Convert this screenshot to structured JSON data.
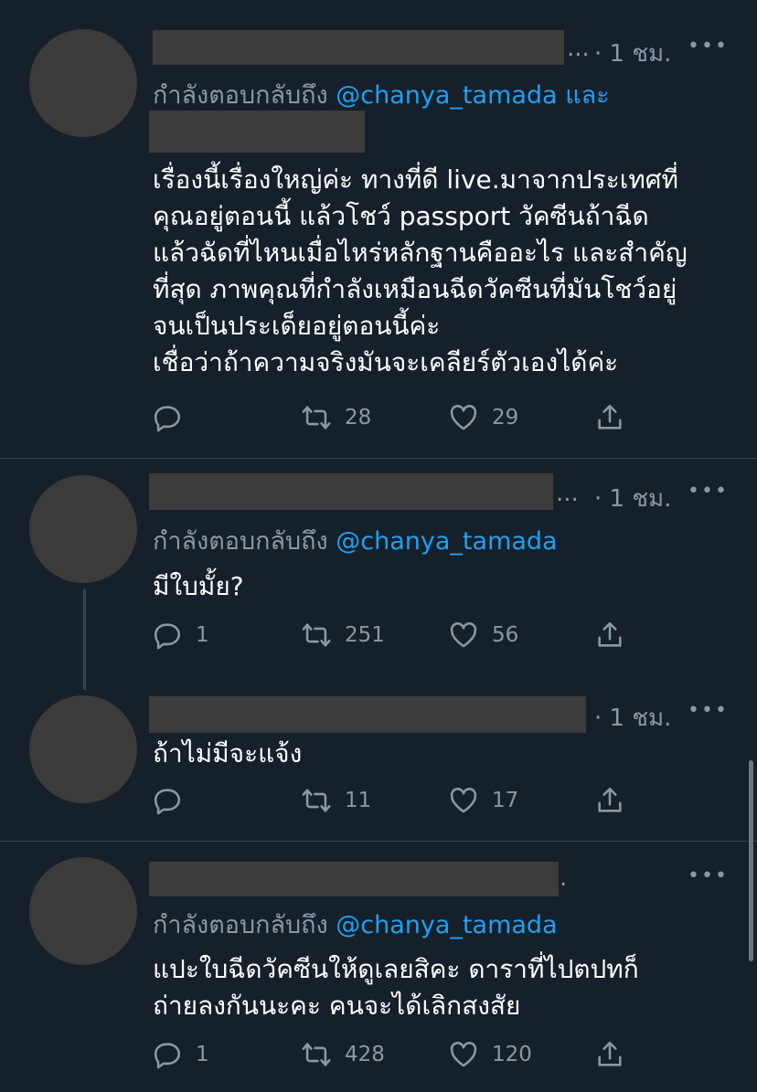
{
  "tweets": [
    {
      "time": "· 1 ชม.",
      "reply_label": "กำลังตอบกลับถึง",
      "reply_to": "@chanya_tamada",
      "reply_suffix": "และ",
      "text": "เรื่องนี้เรื่องใหญ่ค่ะ ทางที่ดี live.มาจากประเทศที่\nคุณอยู่ตอนนี้ แล้วโชว์ passport วัคซีนถ้าฉีด\nแล้วฉัดที่ไหนเมื่อไหร่หลักฐานคืออะไร และสำคัญ\nที่สุด ภาพคุณที่กำลังเหมือนฉีดวัคซีนที่มันโชว์อยู่\nจนเป็นประเด็ยอยู่ตอนนี้ค่ะ\nเชื่อว่าถ้าความจริงมันจะเคลียร์ตัวเองได้ค่ะ",
      "replies": "",
      "retweets": "28",
      "likes": "29"
    },
    {
      "time": "· 1 ชม.",
      "reply_label": "กำลังตอบกลับถึง",
      "reply_to": "@chanya_tamada",
      "text": "มีใบมั้ย?",
      "replies": "1",
      "retweets": "251",
      "likes": "56"
    },
    {
      "time": "· 1 ชม.",
      "text": "ถ้าไม่มีจะแจ้ง",
      "replies": "",
      "retweets": "11",
      "likes": "17"
    },
    {
      "time": ".",
      "reply_label": "กำลังตอบกลับถึง",
      "reply_to": "@chanya_tamada",
      "text": "แปะใบฉีดวัคซีนให้ดูเลยสิคะ ดาราที่ไปตปทก็\nถ่ายลงกันนะคะ คนจะได้เลิกสงสัย",
      "replies": "1",
      "retweets": "428",
      "likes": "120"
    }
  ],
  "ellipsis": "...",
  "more_label": "•••"
}
